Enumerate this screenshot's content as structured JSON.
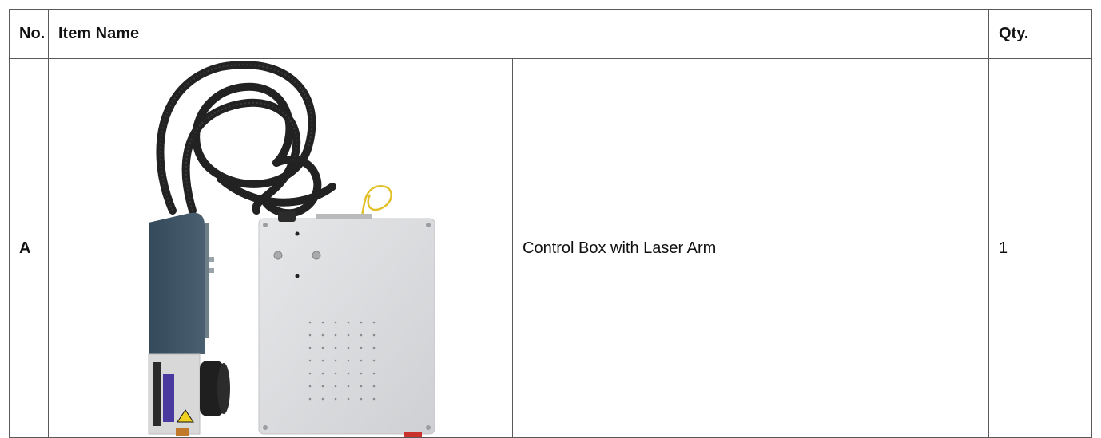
{
  "table": {
    "headers": {
      "no": "No.",
      "item_name": "Item Name",
      "qty": "Qty."
    },
    "rows": [
      {
        "no": "A",
        "image": "control-box-with-laser-arm-photo",
        "description": "Control Box with Laser Arm",
        "qty": "1"
      }
    ]
  },
  "colors": {
    "border": "#5a5a5a",
    "text": "#111111",
    "laser_head": "#3f5461",
    "control_box": "#d9dadc",
    "cable": "#232323"
  }
}
